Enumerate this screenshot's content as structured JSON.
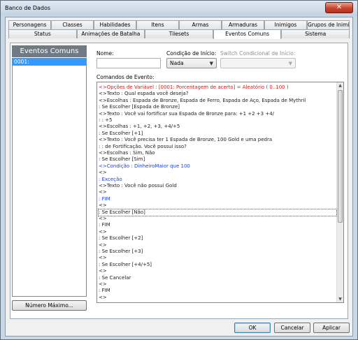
{
  "window": {
    "title": "Banco de Dados",
    "close_glyph": "✕"
  },
  "tabs_row1": [
    "Personagens",
    "Classes",
    "Habilidades",
    "Itens",
    "Armas",
    "Armaduras",
    "Inimigos",
    "Grupos de Inimigos"
  ],
  "tabs_row2": [
    "Status",
    "Animações de Batalha",
    "Tilesets",
    "Eventos Comuns",
    "Sistema"
  ],
  "active_tab": "Eventos Comuns",
  "list": {
    "header": "Eventos Comuns",
    "items": [
      "0001:"
    ],
    "max_button": "Número Máximo..."
  },
  "form": {
    "name_label": "Nome:",
    "name_value": "",
    "condition_label": "Condição de Início:",
    "condition_value": "Nada",
    "switch_label": "Switch Condicional de Início:",
    "switch_value": "",
    "commands_label": "Comandos de Evento:"
  },
  "event_lines": [
    {
      "text": "<>Opções de Variável : [0001: Porcentagem de acerto] = Aleatório ( 0..100 )",
      "color": "red"
    },
    {
      "text": "<>Texto : Qual espada você deseja?",
      "color": ""
    },
    {
      "text": "<>Escolhas : Espada de Bronze, Espada de Ferro, Espada de Aço, Espada de Mythril",
      "color": ""
    },
    {
      "text": ": Se Escolher [Espada de Bronze]",
      "color": ""
    },
    {
      "text": "    <>Texto : Você vai fortificar sua Espada de Bronze para: +1 +2 +3 +4/",
      "color": ""
    },
    {
      "text": "    :         : +5",
      "color": ""
    },
    {
      "text": "    <>Escolhas : +1, +2, +3, +4/+5",
      "color": ""
    },
    {
      "text": "    : Se Escolher [+1]",
      "color": ""
    },
    {
      "text": "        <>Texto : Você precisa ter 1 Espada de Bronze, 100 Gold e uma pedra",
      "color": ""
    },
    {
      "text": "        :         : de Fortificação. Você possui isso?",
      "color": ""
    },
    {
      "text": "        <>Escolhas : Sim, Não",
      "color": ""
    },
    {
      "text": "        : Se Escolher [Sim]",
      "color": ""
    },
    {
      "text": "            <>Condição : DinheiroMaior que 100",
      "color": "blue"
    },
    {
      "text": "                <>",
      "color": ""
    },
    {
      "text": "            : Exceção",
      "color": "blue"
    },
    {
      "text": "                <>Texto : Você não possui Gold",
      "color": ""
    },
    {
      "text": "                <>",
      "color": ""
    },
    {
      "text": "            : FIM",
      "color": "blue"
    },
    {
      "text": "            <>",
      "color": ""
    },
    {
      "text": "        : Se Escolher [Não]",
      "color": ""
    },
    {
      "text": "            <>",
      "color": ""
    },
    {
      "text": "        : FIM",
      "color": ""
    },
    {
      "text": "        <>",
      "color": ""
    },
    {
      "text": "    : Se Escolher [+2]",
      "color": ""
    },
    {
      "text": "        <>",
      "color": ""
    },
    {
      "text": "    : Se Escolher [+3]",
      "color": ""
    },
    {
      "text": "        <>",
      "color": ""
    },
    {
      "text": "    : Se Escolher [+4/+5]",
      "color": ""
    },
    {
      "text": "        <>",
      "color": ""
    },
    {
      "text": "    : Se Cancelar",
      "color": ""
    },
    {
      "text": "        <>",
      "color": ""
    },
    {
      "text": "    : FIM",
      "color": ""
    },
    {
      "text": "    <>",
      "color": ""
    }
  ],
  "selected_line_index": 19,
  "footer": {
    "ok": "OK",
    "cancel": "Cancelar",
    "apply": "Aplicar"
  },
  "scrollbar": {
    "up_glyph": "▲",
    "down_glyph": "▼",
    "dropdown_glyph": "▼"
  }
}
